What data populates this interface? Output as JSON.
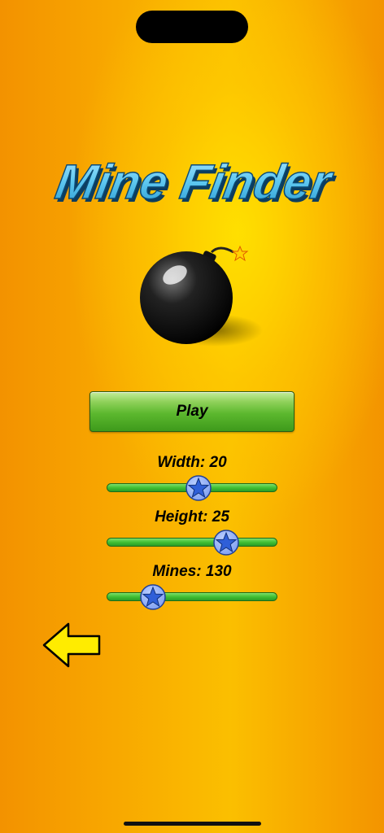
{
  "title": "Mine Finder",
  "play_label": "Play",
  "settings": [
    {
      "label": "Width: 20",
      "fraction": 0.54
    },
    {
      "label": "Height: 25",
      "fraction": 0.7
    },
    {
      "label": "Mines: 130",
      "fraction": 0.27
    }
  ],
  "icons": {
    "bomb": "bomb-icon",
    "back": "back-arrow-icon",
    "slider_thumb": "star-icon"
  },
  "colors": {
    "title_fill": "#5fc8f0",
    "play_button": "#5cb82e",
    "slider_track": "#42c035",
    "thumb": "#4d7fe6",
    "arrow": "#ffec00"
  }
}
